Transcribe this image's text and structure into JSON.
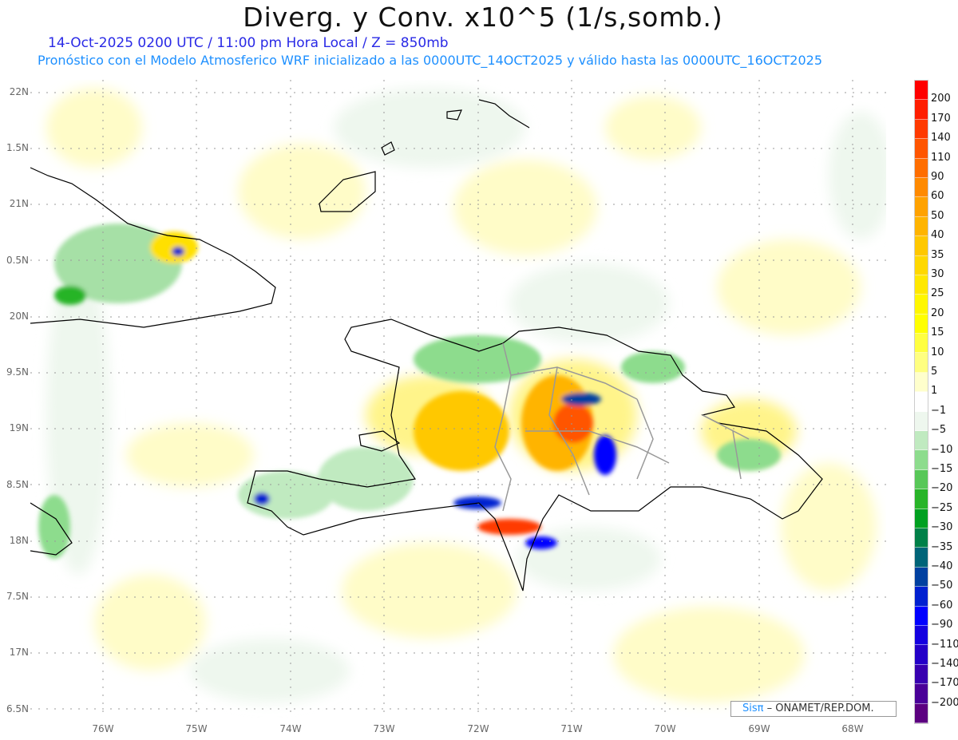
{
  "header": {
    "title": "Diverg. y Conv. x10^5 (1/s,somb.)",
    "subtitle_time": "14-Oct-2025  0200 UTC / 11:00 pm Hora Local / Z = 850mb",
    "subtitle_model": "Pronóstico con el Modelo Atmosferico WRF inicializado a las 0000UTC_14OCT2025 y válido hasta las  0000UTC_16OCT2025"
  },
  "axes": {
    "lat_labels": [
      "22N",
      "1.5N",
      "21N",
      "0.5N",
      "20N",
      "9.5N",
      "19N",
      "8.5N",
      "18N",
      "7.5N",
      "17N",
      "6.5N"
    ],
    "lon_labels": [
      "76W",
      "75W",
      "74W",
      "73W",
      "72W",
      "71W",
      "70W",
      "69W",
      "68W"
    ]
  },
  "colorbar": {
    "labels": [
      "200",
      "170",
      "140",
      "110",
      "90",
      "60",
      "50",
      "40",
      "35",
      "30",
      "25",
      "20",
      "15",
      "10",
      "5",
      "1",
      "−1",
      "−5",
      "−10",
      "−15",
      "−20",
      "−25",
      "−30",
      "−35",
      "−40",
      "−50",
      "−60",
      "−90",
      "−110",
      "−140",
      "−170",
      "−200"
    ],
    "colors": [
      "#ff0000",
      "#ff1e00",
      "#ff3a00",
      "#ff5500",
      "#ff6e00",
      "#ff8a00",
      "#ffa200",
      "#ffb400",
      "#ffc800",
      "#ffd800",
      "#ffe800",
      "#fff700",
      "#ffff00",
      "#ffff40",
      "#ffff80",
      "#ffffcc",
      "#ffffff",
      "#eef7ee",
      "#c0eac0",
      "#8ddc8d",
      "#58c758",
      "#28b428",
      "#00a020",
      "#008048",
      "#006478",
      "#0040a0",
      "#0020d0",
      "#0000ff",
      "#1400e0",
      "#2400c8",
      "#3800b0",
      "#4a0098",
      "#5c0080"
    ]
  },
  "credit": {
    "brand": "Sisπ",
    "org": " –  ONAMET/REP.DOM."
  }
}
